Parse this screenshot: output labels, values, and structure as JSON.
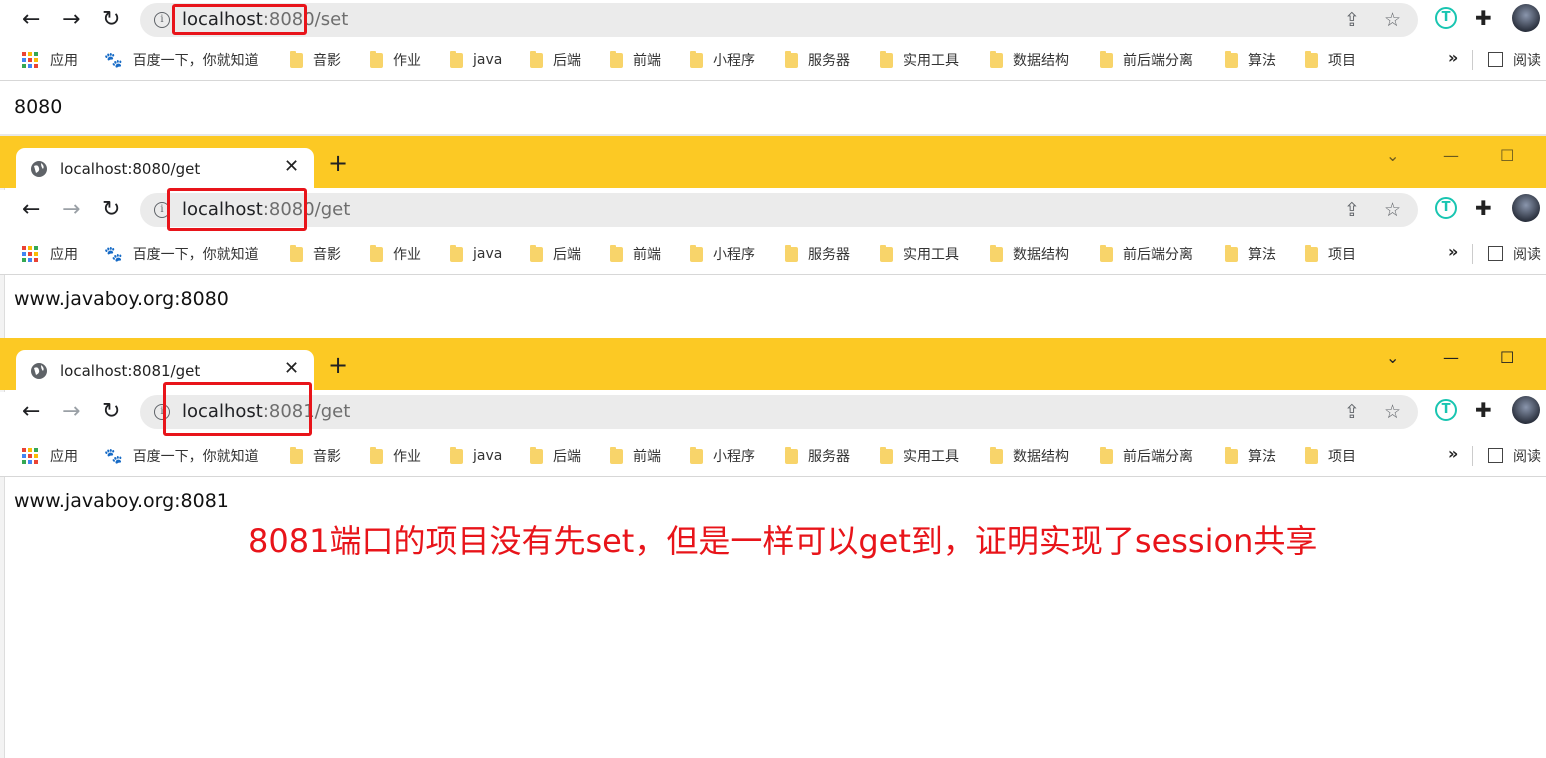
{
  "bookmarks": [
    {
      "label": "应用",
      "type": "apps"
    },
    {
      "label": "百度一下，你就知道",
      "type": "baidu"
    },
    {
      "label": "音影",
      "type": "folder"
    },
    {
      "label": "作业",
      "type": "folder"
    },
    {
      "label": "java",
      "type": "folder"
    },
    {
      "label": "后端",
      "type": "folder"
    },
    {
      "label": "前端",
      "type": "folder"
    },
    {
      "label": "小程序",
      "type": "folder"
    },
    {
      "label": "服务器",
      "type": "folder"
    },
    {
      "label": "实用工具",
      "type": "folder"
    },
    {
      "label": "数据结构",
      "type": "folder"
    },
    {
      "label": "前后端分离",
      "type": "folder"
    },
    {
      "label": "算法",
      "type": "folder"
    },
    {
      "label": "项目",
      "type": "folder"
    }
  ],
  "bookmarks_more": "»",
  "reading_list": "阅读",
  "windows": [
    {
      "url_host": "localhost",
      "url_rest": ":8080/set",
      "content": "8080"
    },
    {
      "tab_title": "localhost:8080/get",
      "url_host": "localhost",
      "url_rest": ":8080/get",
      "content": "www.javaboy.org:8080"
    },
    {
      "tab_title": "localhost:8081/get",
      "url_host": "localhost",
      "url_rest": ":8081/get",
      "content": "www.javaboy.org:8081"
    }
  ],
  "annotation": "8081端口的项目没有先set，但是一样可以get到，证明实现了session共享",
  "colors": {
    "titlebar": "#fcc924",
    "highlight_box": "#e8141a",
    "annotation_text": "#e8141a",
    "omnibox": "#ebebeb",
    "folder": "#f8d46a"
  },
  "icons": {
    "back": "arrow-left-icon",
    "forward": "arrow-right-icon",
    "reload": "reload-icon",
    "info": "info-icon",
    "share": "share-icon",
    "bookmark_star": "star-icon",
    "extension_t": "translate-extension-icon",
    "extensions": "puzzle-icon",
    "profile": "avatar",
    "globe": "globe-icon",
    "close": "close-icon",
    "new_tab": "plus-icon"
  }
}
